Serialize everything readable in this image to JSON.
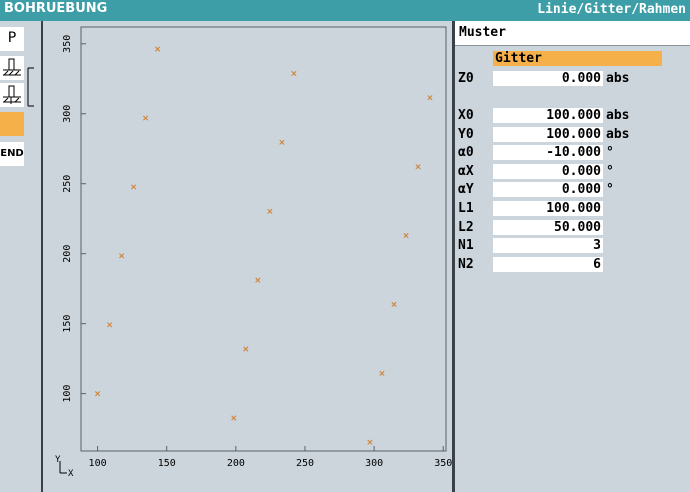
{
  "window": {
    "title": "BOHRUEBUNG",
    "context": "Linie/Gitter/Rahmen"
  },
  "left_toolbar": {
    "program_label": "P",
    "end_label": "END"
  },
  "panel": {
    "title": "Muster",
    "mode": "Gitter",
    "params": [
      {
        "label": "Z0",
        "value": "0.000",
        "unit": "abs"
      },
      {
        "label": "X0",
        "value": "100.000",
        "unit": "abs"
      },
      {
        "label": "Y0",
        "value": "100.000",
        "unit": "abs"
      },
      {
        "label": "α0",
        "value": "-10.000",
        "unit": "°"
      },
      {
        "label": "αX",
        "value": "0.000",
        "unit": "°"
      },
      {
        "label": "αY",
        "value": "0.000",
        "unit": "°"
      },
      {
        "label": "L1",
        "value": "100.000",
        "unit": ""
      },
      {
        "label": "L2",
        "value": "50.000",
        "unit": ""
      },
      {
        "label": "N1",
        "value": "3",
        "unit": ""
      },
      {
        "label": "N2",
        "value": "6",
        "unit": ""
      }
    ]
  },
  "chart_data": {
    "type": "scatter",
    "xlabel": "X",
    "ylabel": "Y",
    "xlim": [
      88,
      352
    ],
    "ylim": [
      59,
      362
    ],
    "xticks": [
      100,
      150,
      200,
      250,
      300,
      350
    ],
    "yticks": [
      100,
      150,
      200,
      250,
      300,
      350
    ],
    "grid": false,
    "marker_color": "#d0843a",
    "points": [
      [
        100,
        100
      ],
      [
        108.7,
        149.2
      ],
      [
        117.4,
        198.5
      ],
      [
        126.0,
        247.7
      ],
      [
        134.7,
        296.9
      ],
      [
        143.4,
        346.2
      ],
      [
        198.5,
        82.6
      ],
      [
        207.2,
        131.9
      ],
      [
        215.9,
        181.1
      ],
      [
        224.6,
        230.3
      ],
      [
        233.3,
        279.6
      ],
      [
        242.0,
        328.8
      ],
      [
        297.0,
        65.3
      ],
      [
        305.7,
        114.5
      ],
      [
        314.4,
        163.8
      ],
      [
        323.1,
        213.0
      ],
      [
        331.8,
        262.2
      ],
      [
        340.4,
        311.5
      ]
    ]
  }
}
